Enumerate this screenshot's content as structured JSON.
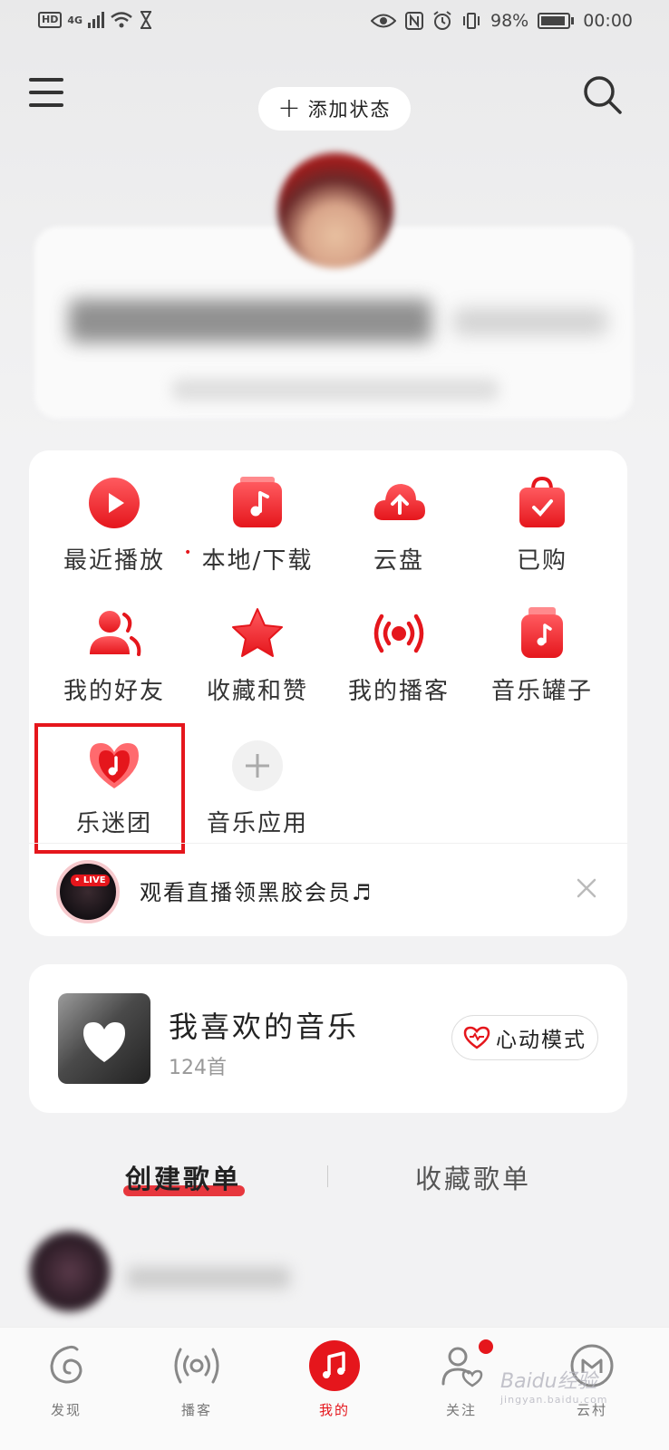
{
  "status_bar": {
    "hd": "HD",
    "network": "4G",
    "battery": "98%",
    "time": "00:00"
  },
  "header": {
    "add_status_plus": "+",
    "add_status_label": "添加状态"
  },
  "grid": {
    "items": [
      {
        "label": "最近播放",
        "icon": "play-circle-icon"
      },
      {
        "label": "本地/下载",
        "icon": "music-box-icon"
      },
      {
        "label": "云盘",
        "icon": "cloud-upload-icon"
      },
      {
        "label": "已购",
        "icon": "shopping-bag-icon"
      },
      {
        "label": "我的好友",
        "icon": "friends-icon"
      },
      {
        "label": "收藏和赞",
        "icon": "star-icon"
      },
      {
        "label": "我的播客",
        "icon": "podcast-icon"
      },
      {
        "label": "音乐罐子",
        "icon": "music-jar-icon"
      },
      {
        "label": "乐迷团",
        "icon": "fan-club-heart-icon"
      },
      {
        "label": "音乐应用",
        "icon": "add-app-icon"
      }
    ],
    "dot_separator": "•"
  },
  "live_banner": {
    "badge": "• LIVE",
    "text": "观看直播领黑胶会员♬"
  },
  "liked_music": {
    "title": "我喜欢的音乐",
    "count": "124首",
    "heart_mode": "心动模式"
  },
  "tabs": {
    "created": "创建歌单",
    "favorited": "收藏歌单"
  },
  "bottom_nav": {
    "items": [
      {
        "label": "发现",
        "icon": "discover-icon"
      },
      {
        "label": "播客",
        "icon": "podcast-icon"
      },
      {
        "label": "我的",
        "icon": "music-note-icon"
      },
      {
        "label": "关注",
        "icon": "follow-icon"
      },
      {
        "label": "云村",
        "icon": "cloud-village-icon"
      }
    ],
    "active_index": 2
  },
  "watermark": {
    "text": "Baidu经验",
    "sub": "jingyan.baidu.com"
  },
  "colors": {
    "accent": "#e5161c",
    "background": "#f2f2f3"
  }
}
